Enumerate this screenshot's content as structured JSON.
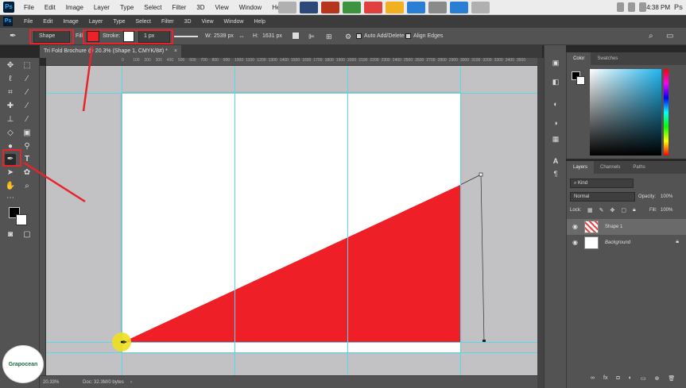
{
  "menubar": {
    "app_logo": "Ps",
    "items": [
      "File",
      "Edit",
      "Image",
      "Layer",
      "Type",
      "Select",
      "Filter",
      "3D",
      "View",
      "Window",
      "Help"
    ],
    "clock": "4:38 PM",
    "right_logo": "Ps"
  },
  "options": {
    "mode": "Shape",
    "fill_label": "Fill:",
    "stroke_label": "Stroke:",
    "stroke_width": "1 px",
    "w_label": "W:",
    "w_value": "2539 px",
    "h_label": "H:",
    "h_value": "1631 px",
    "auto_add_delete": "Auto Add/Delete",
    "align_edges": "Align Edges",
    "fill_color": "#e8232a"
  },
  "document": {
    "tab_title": "Tri Fold Brochure @ 20.3% (Shape 1, CMYK/8#) *",
    "zoom": "20.33%",
    "doc_size": "Doc: 32.3M/0 bytes",
    "shape_color": "#ee1f26"
  },
  "ruler": {
    "ticks": [
      "0",
      "100",
      "200",
      "300",
      "400",
      "500",
      "600",
      "700",
      "800",
      "900",
      "1000",
      "1100",
      "1200",
      "1300",
      "1400",
      "1500",
      "1600",
      "1700",
      "1800",
      "1900",
      "2000",
      "2100",
      "2200",
      "2300",
      "2400",
      "2500",
      "2600",
      "2700",
      "2800",
      "2900",
      "3000",
      "3100",
      "3200",
      "3300",
      "3400",
      "3500"
    ]
  },
  "color_panel": {
    "tabs": [
      "Color",
      "Swatches"
    ]
  },
  "layers_panel": {
    "tabs": [
      "Layers",
      "Channels",
      "Paths"
    ],
    "filter": "Kind",
    "blend_mode": "Normal",
    "opacity_label": "Opacity:",
    "opacity": "100%",
    "lock_label": "Lock:",
    "fill_label": "Fill:",
    "fill": "100%",
    "layers": [
      {
        "name": "Shape 1"
      },
      {
        "name": "Background"
      }
    ]
  },
  "watermark": {
    "text": "Grapocean"
  }
}
